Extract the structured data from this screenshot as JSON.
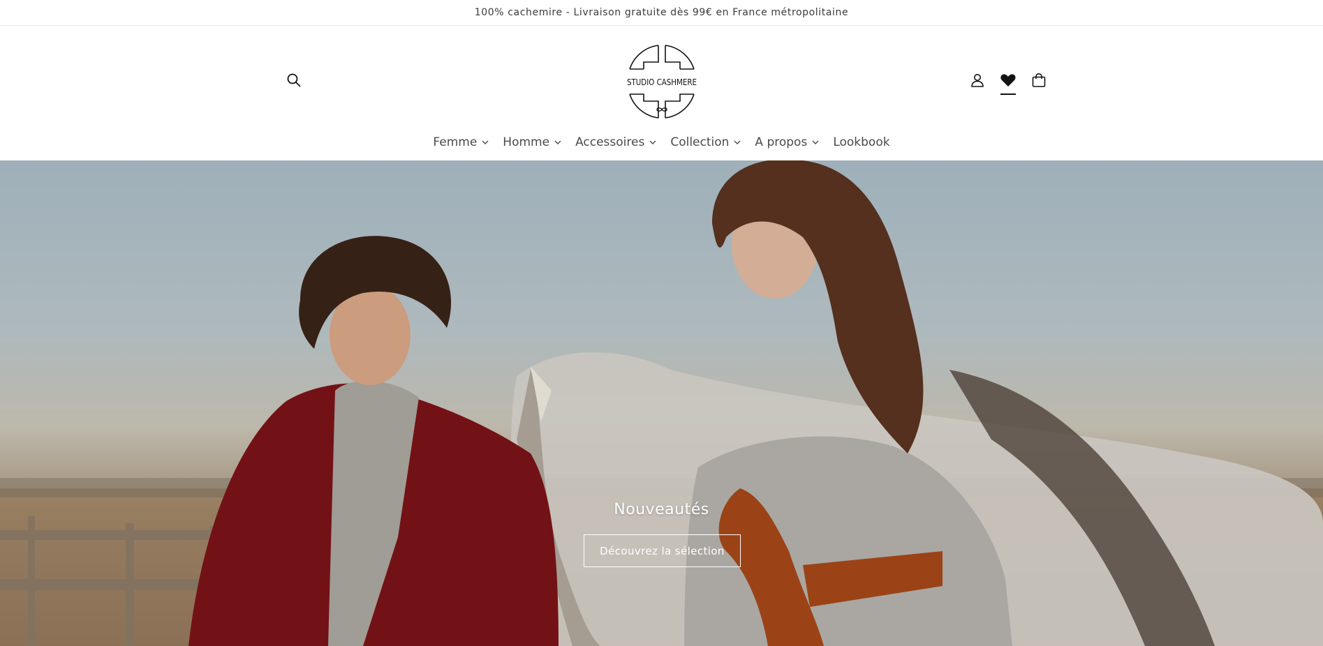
{
  "announcement": {
    "text": "100% cachemire - Livraison gratuite dès 99€ en France métropolitaine"
  },
  "header": {
    "logo_text": "STUDIO CASHMERE",
    "icons": {
      "search": "search-icon",
      "account": "account-icon",
      "wishlist": "heart-icon",
      "cart": "shopping-bag-icon"
    }
  },
  "nav": {
    "items": [
      {
        "label": "Femme",
        "has_dropdown": true
      },
      {
        "label": "Homme",
        "has_dropdown": true
      },
      {
        "label": "Accessoires",
        "has_dropdown": true
      },
      {
        "label": "Collection",
        "has_dropdown": true
      },
      {
        "label": "A propos",
        "has_dropdown": true
      },
      {
        "label": "Lookbook",
        "has_dropdown": false
      }
    ]
  },
  "hero": {
    "title": "Nouveautés",
    "cta_label": "Découvrez la sélection"
  },
  "colors": {
    "text": "#121212",
    "nav_text": "#4a4a4a",
    "hero_text": "#ffffff",
    "divider": "#e6e6e6"
  }
}
